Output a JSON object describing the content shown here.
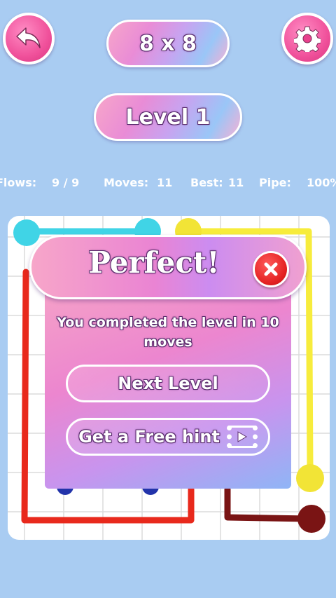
{
  "header": {
    "back_icon": "back-arrow-icon",
    "settings_icon": "gear-icon",
    "grid_size": "8 x 8",
    "level": "Level 1"
  },
  "stats": {
    "flows_label": "Flows:",
    "flows_value": "9 / 9",
    "moves_label": "Moves:",
    "moves_value": "11",
    "best_label": "Best:",
    "best_value": "11",
    "pipe_label": "Pipe:",
    "pipe_value": "100%"
  },
  "board": {
    "colors": {
      "cyan": "#40d4e6",
      "yellow": "#f7ec3c",
      "red": "#e8291c",
      "dark_red": "#7a1414",
      "blue": "#2233aa"
    }
  },
  "modal": {
    "title": "Perfect!",
    "close_icon": "close-icon",
    "message": "You completed the level in 10 moves",
    "next_label": "Next Level",
    "hint_label": "Get a Free hint",
    "video_icon": "play-video-icon"
  }
}
